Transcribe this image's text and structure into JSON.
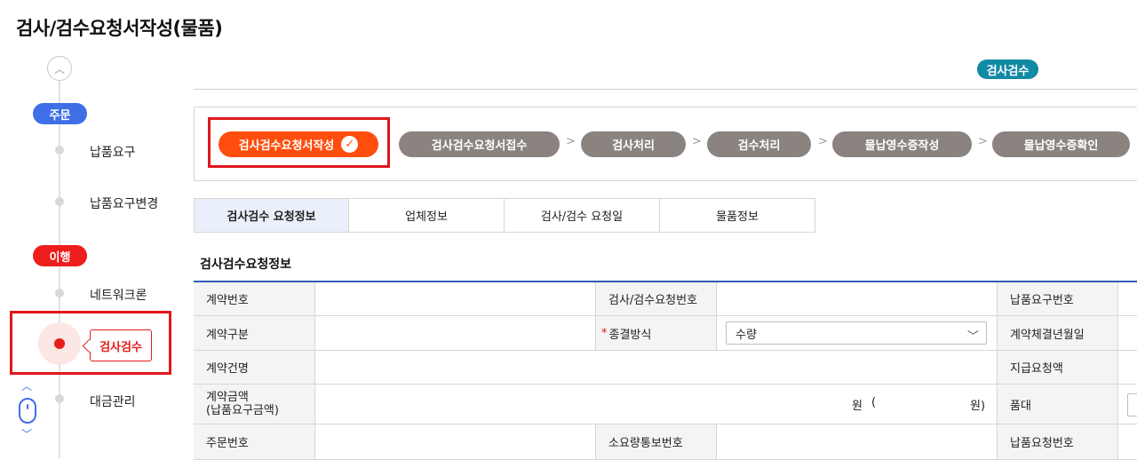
{
  "page": {
    "title": "검사/검수요청서작성(물품)"
  },
  "sidebar": {
    "stage_order": "주문",
    "stage_exec": "이행",
    "items": [
      {
        "label": "납품요구"
      },
      {
        "label": "납품요구변경"
      },
      {
        "label": "네트워크론"
      },
      {
        "label": "검사검수"
      },
      {
        "label": "대금관리"
      }
    ]
  },
  "badge": "검사검수",
  "steps": [
    {
      "label": "검사검수요청서작성",
      "state": "current"
    },
    {
      "label": "검사검수요청서접수"
    },
    {
      "label": "검사처리"
    },
    {
      "label": "검수처리"
    },
    {
      "label": "물납영수증작성"
    },
    {
      "label": "물납영수증확인"
    }
  ],
  "step_separator": ">",
  "tabs": [
    "검사검수 요청정보",
    "업체정보",
    "검사/검수 요청일",
    "물품정보"
  ],
  "section_title": "검사검수요청정보",
  "form": {
    "contract_no": "계약번호",
    "inspection_req_no": "검사/검수요청번호",
    "delivery_req_no": "납품요구번호",
    "contract_type": "계약구분",
    "required_mark": "*",
    "settlement_method": "종결방식",
    "settlement_value": "수량",
    "contract_date": "계약체결년월일",
    "contract_name": "계약건명",
    "payment_amount": "지급요청액",
    "contract_amount_l1": "계약금액",
    "contract_amount_l2": "(납품요구금액)",
    "currency_won": "원",
    "paren_open": "(",
    "won_close": "원)",
    "item": "품대",
    "order_no": "주문번호",
    "requirement_no": "소요량통보번호",
    "delivery_request_no": "납품요청번호"
  },
  "colors": {
    "primary_blue": "#3f6fe6",
    "accent_red": "#e0171d",
    "step_current": "#ff4d0d",
    "step_default": "#8a8380",
    "badge_teal": "#118aa4"
  },
  "icons": [
    "chevron-up-icon",
    "check-icon",
    "mouse-scroll-icon",
    "chevron-down-icon"
  ]
}
